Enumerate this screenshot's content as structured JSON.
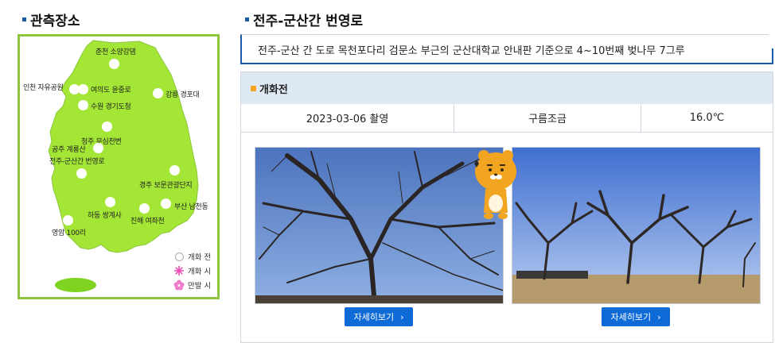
{
  "left": {
    "title": "관측장소",
    "locations": [
      {
        "name": "춘천 소양강댐"
      },
      {
        "name": "인천 자유공원"
      },
      {
        "name": "여의도 윤중로"
      },
      {
        "name": "수원 경기도청"
      },
      {
        "name": "강릉 경포대"
      },
      {
        "name": "청주 무심천변"
      },
      {
        "name": "공주 계룡산"
      },
      {
        "name": "전주-군산간 번영로"
      },
      {
        "name": "경주 보문관광단지"
      },
      {
        "name": "부산 남천동"
      },
      {
        "name": "하동 쌍계사"
      },
      {
        "name": "진해 여좌천"
      },
      {
        "name": "영암 100리"
      }
    ],
    "legend": [
      {
        "label": "개화 전",
        "icon": "empty-circle-icon"
      },
      {
        "label": "개화 시",
        "icon": "pink-flower-outline-icon"
      },
      {
        "label": "만발 시",
        "icon": "pink-flower-filled-icon"
      }
    ],
    "colors": {
      "land": "#a3e635",
      "border": "#8dc63f",
      "jeju": "#7fd321"
    }
  },
  "right": {
    "title": "전주-군산간 번영로",
    "description": "전주-군산 간 도로 목천포다리 검문소 부근의 군산대학교 안내판 기준으로 4~10번째 벚나무 7그루",
    "status": "개화전",
    "date": "2023-03-06 촬영",
    "weather": "구름조금",
    "temperature": "16.0℃",
    "button_label": "자세히보기",
    "colors": {
      "accent": "#1a5aa8",
      "button": "#0e6ad6",
      "status_marker": "#f5a623",
      "header_bg": "#dfe9f3"
    }
  }
}
